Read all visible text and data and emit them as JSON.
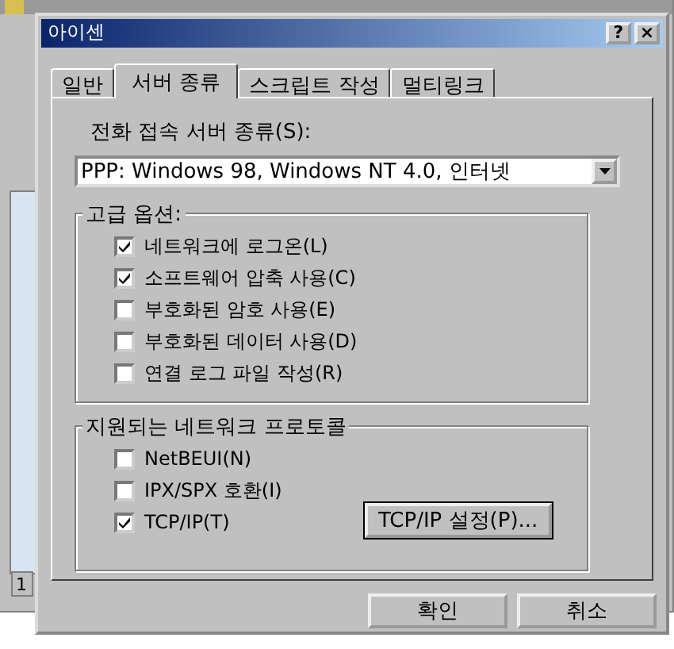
{
  "background_window": {
    "status_text": "1"
  },
  "window": {
    "title": "아이센",
    "help_button": "?",
    "close_button": "×"
  },
  "tabs": [
    {
      "label": "일반",
      "selected": false
    },
    {
      "label": "서버 종류",
      "selected": true
    },
    {
      "label": "스크립트 작성",
      "selected": false
    },
    {
      "label": "멀티링크",
      "selected": false
    }
  ],
  "server_type": {
    "label": "전화 접속 서버 종류(S):",
    "value": "PPP: Windows 98, Windows NT 4.0, 인터넷"
  },
  "advanced_options": {
    "title": "고급 옵션:",
    "items": [
      {
        "label": "네트워크에 로그온(L)",
        "checked": true
      },
      {
        "label": "소프트웨어 압축 사용(C)",
        "checked": true
      },
      {
        "label": "부호화된 암호 사용(E)",
        "checked": false
      },
      {
        "label": "부호화된 데이터 사용(D)",
        "checked": false
      },
      {
        "label": "연결 로그 파일 작성(R)",
        "checked": false
      }
    ]
  },
  "protocols": {
    "title": "지원되는 네트워크 프로토콜",
    "items": [
      {
        "label": "NetBEUI(N)",
        "checked": false
      },
      {
        "label": "IPX/SPX 호환(I)",
        "checked": false
      },
      {
        "label": "TCP/IP(T)",
        "checked": true
      }
    ],
    "settings_button": "TCP/IP 설정(P)..."
  },
  "buttons": [
    "확인",
    "취소"
  ]
}
